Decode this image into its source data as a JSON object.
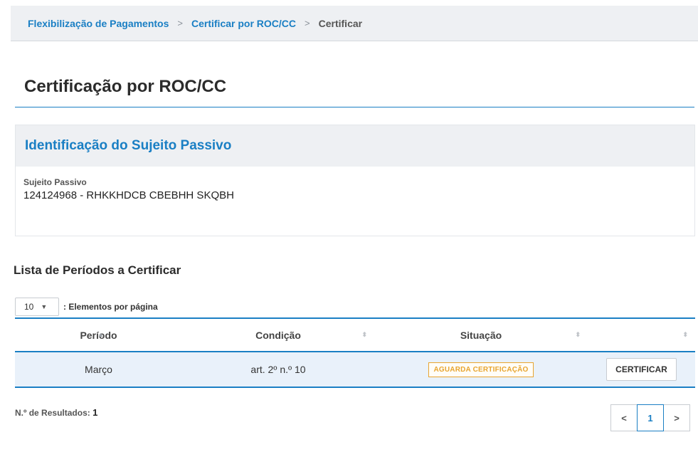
{
  "breadcrumb": {
    "items": [
      "Flexibilização de Pagamentos",
      "Certificar por ROC/CC"
    ],
    "current": "Certificar",
    "separator": ">"
  },
  "page": {
    "title": "Certificação por ROC/CC"
  },
  "identification": {
    "header": "Identificação do Sujeito Passivo",
    "field_label": "Sujeito Passivo",
    "field_value": "124124968 - RHKKHDCB CBEBHH SKQBH"
  },
  "list": {
    "title": "Lista de Períodos a Certificar",
    "page_size": "10",
    "page_size_label": ": Elementos por página",
    "columns": [
      "Período",
      "Condição",
      "Situação",
      ""
    ],
    "rows": [
      {
        "periodo": "Março",
        "condicao": "art. 2º n.º 10",
        "situacao": "AGUARDA CERTIFICAÇÃO",
        "action": "CERTIFICAR"
      }
    ],
    "results_label": "N.º de Resultados:",
    "results_count": "1"
  },
  "pagination": {
    "prev": "<",
    "current": "1",
    "next": ">"
  },
  "colors": {
    "accent": "#1a7fc4",
    "status": "#e8a530",
    "row_bg": "#e9f1fa"
  }
}
